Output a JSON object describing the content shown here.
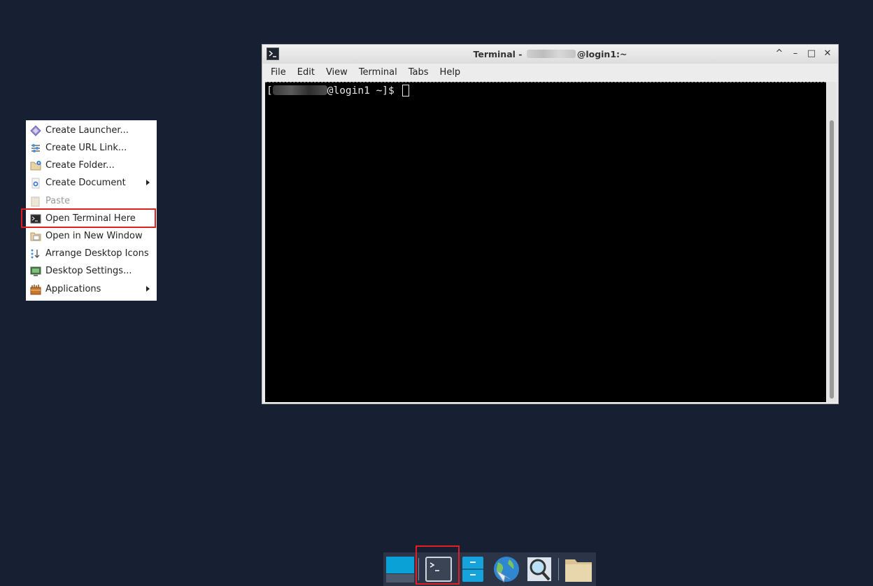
{
  "context_menu": {
    "items": [
      {
        "label": "Create Launcher...",
        "icon": "launcher-icon",
        "submenu": false,
        "disabled": false
      },
      {
        "label": "Create URL Link...",
        "icon": "url-link-icon",
        "submenu": false,
        "disabled": false
      },
      {
        "label": "Create Folder...",
        "icon": "new-folder-icon",
        "submenu": false,
        "disabled": false
      },
      {
        "label": "Create Document",
        "icon": "new-document-icon",
        "submenu": true,
        "disabled": false
      },
      {
        "label": "Paste",
        "icon": "paste-icon",
        "submenu": false,
        "disabled": true
      },
      {
        "label": "Open Terminal Here",
        "icon": "terminal-icon",
        "submenu": false,
        "disabled": false
      },
      {
        "label": "Open in New Window",
        "icon": "window-icon",
        "submenu": false,
        "disabled": false
      },
      {
        "label": "Arrange Desktop Icons",
        "icon": "arrange-icon",
        "submenu": false,
        "disabled": false
      },
      {
        "label": "Desktop Settings...",
        "icon": "desktop-settings-icon",
        "submenu": false,
        "disabled": false
      },
      {
        "label": "Applications",
        "icon": "applications-icon",
        "submenu": true,
        "disabled": false
      }
    ]
  },
  "terminal": {
    "title_prefix": "Terminal -",
    "title_suffix": "@login1:~",
    "menu": [
      "File",
      "Edit",
      "View",
      "Terminal",
      "Tabs",
      "Help"
    ],
    "prompt_open": "[",
    "prompt_rest": "@login1 ~]$ ",
    "buttons": {
      "shade": "^",
      "minimize": "–",
      "maximize": "□",
      "close": "✕"
    }
  },
  "dock": {
    "items": [
      "desktop-icon",
      "terminal-icon",
      "file-manager-icon",
      "web-browser-icon",
      "search-icon",
      "folder-icon"
    ]
  },
  "colors": {
    "desktop_bg": "#172033",
    "highlight": "#e02020",
    "terminal_bg": "#000000"
  }
}
